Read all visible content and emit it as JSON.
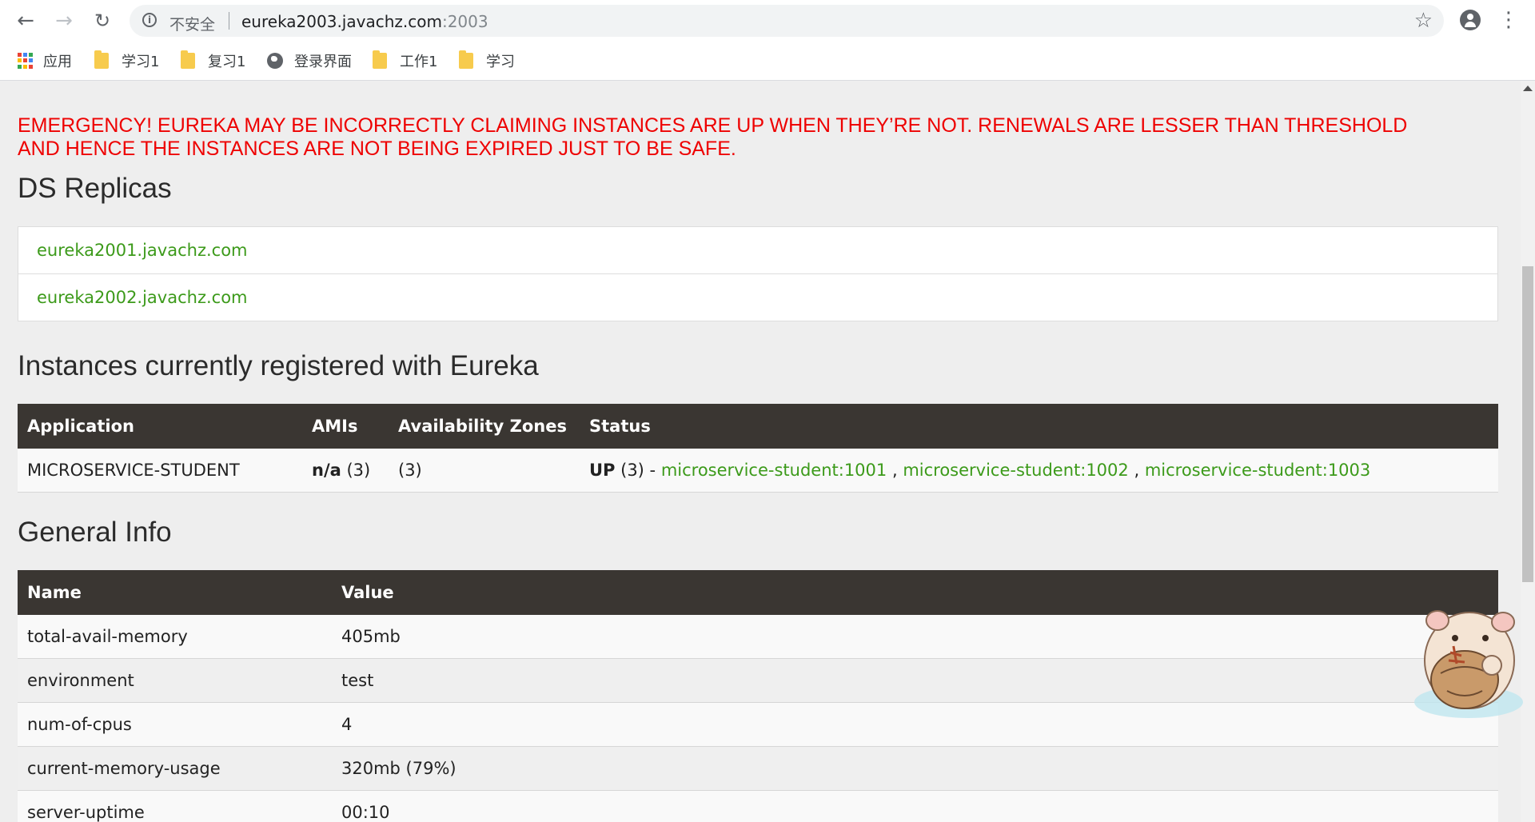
{
  "browser": {
    "url_host": "eureka2003.javachz.com",
    "url_port": ":2003",
    "security_label": "不安全",
    "bookmarks": [
      {
        "label": "应用",
        "icon": "apps-grid-icon"
      },
      {
        "label": "学习1",
        "icon": "folder-icon"
      },
      {
        "label": "复习1",
        "icon": "folder-icon"
      },
      {
        "label": "登录界面",
        "icon": "globe-icon"
      },
      {
        "label": "工作1",
        "icon": "folder-icon"
      },
      {
        "label": "学习",
        "icon": "folder-icon"
      }
    ]
  },
  "page": {
    "emergency": "EMERGENCY! EUREKA MAY BE INCORRECTLY CLAIMING INSTANCES ARE UP WHEN THEY’RE NOT. RENEWALS ARE LESSER THAN THRESHOLD AND HENCE THE INSTANCES ARE NOT BEING EXPIRED JUST TO BE SAFE.",
    "ds_replicas_title": "DS Replicas",
    "ds_replicas": [
      "eureka2001.javachz.com",
      "eureka2002.javachz.com"
    ],
    "instances_title": "Instances currently registered with Eureka",
    "instances_headers": [
      "Application",
      "AMIs",
      "Availability Zones",
      "Status"
    ],
    "instance": {
      "application": "MICROSERVICE-STUDENT",
      "amis_bold": "n/a",
      "amis_count": " (3)",
      "zones": "(3)",
      "status_bold": "UP",
      "status_count": " (3) - ",
      "links": [
        "microservice-student:1001",
        "microservice-student:1002",
        "microservice-student:1003"
      ],
      "link_sep": " , "
    },
    "general_title": "General Info",
    "general_headers": [
      "Name",
      "Value"
    ],
    "general_rows": [
      {
        "name": "total-avail-memory",
        "value": "405mb"
      },
      {
        "name": "environment",
        "value": "test"
      },
      {
        "name": "num-of-cpus",
        "value": "4"
      },
      {
        "name": "current-memory-usage",
        "value": "320mb (79%)"
      },
      {
        "name": "server-uptime",
        "value": "00:10"
      }
    ]
  },
  "colors": {
    "emergency": "#ee0000",
    "link": "#3c9a1a",
    "table_header": "#3a3632"
  }
}
